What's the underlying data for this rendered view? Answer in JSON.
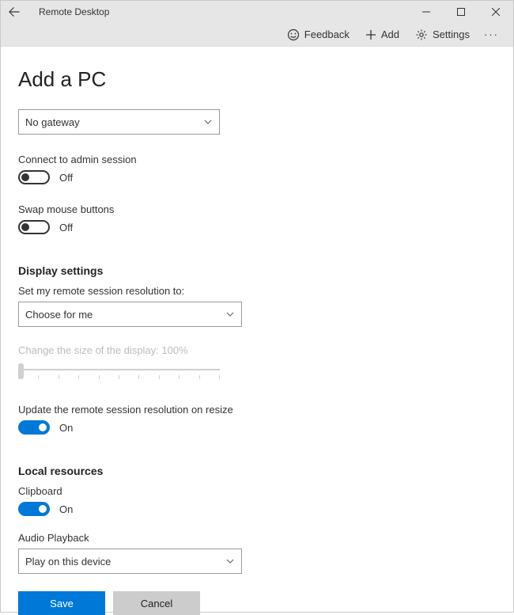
{
  "titlebar": {
    "app_title": "Remote Desktop",
    "cmds": {
      "feedback": "Feedback",
      "add": "Add",
      "settings": "Settings"
    }
  },
  "page": {
    "title": "Add a PC"
  },
  "gateway": {
    "selected": "No gateway"
  },
  "admin_session": {
    "label": "Connect to admin session",
    "state_label": "Off",
    "on": false
  },
  "swap_mouse": {
    "label": "Swap mouse buttons",
    "state_label": "Off",
    "on": false
  },
  "display": {
    "section_title": "Display settings",
    "resolution_label": "Set my remote session resolution to:",
    "resolution_selected": "Choose for me",
    "scale_label": "Change the size of the display: 100%",
    "update_on_resize_label": "Update the remote session resolution on resize",
    "update_on_resize_state": "On",
    "update_on_resize_on": true
  },
  "local": {
    "section_title": "Local resources",
    "clipboard_label": "Clipboard",
    "clipboard_state": "On",
    "clipboard_on": true,
    "audio_label": "Audio Playback",
    "audio_selected": "Play on this device"
  },
  "buttons": {
    "save": "Save",
    "cancel": "Cancel"
  }
}
